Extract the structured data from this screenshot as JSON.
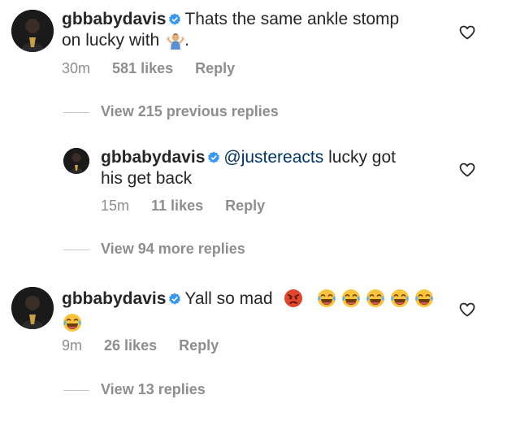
{
  "comments": [
    {
      "username": "gbbabydavis",
      "line1": "Thats the same ankle stomp",
      "line2": "on lucky with",
      "line2_suffix": ".",
      "time": "30m",
      "likes": "581 likes",
      "reply": "Reply",
      "view_replies": "View 215 previous replies"
    },
    {
      "username": "gbbabydavis",
      "mention": "@justereacts",
      "line1_rest": "lucky got",
      "line2": "his get back",
      "time": "15m",
      "likes": "11 likes",
      "reply": "Reply",
      "view_replies": "View 94 more replies"
    },
    {
      "username": "gbbabydavis",
      "line1": "Yall so mad",
      "time": "9m",
      "likes": "26 likes",
      "reply": "Reply",
      "view_replies": "View 13 replies"
    }
  ],
  "icons": {
    "verified": "verified-badge-icon",
    "heart": "heart-outline-icon",
    "shrug": "shrug-emoji",
    "angry": "angry-face-emoji",
    "laughing": "tears-of-joy-emoji"
  },
  "colors": {
    "text": "#262626",
    "secondary": "#8e8e8e",
    "verified": "#3897f0",
    "mention": "#003569"
  }
}
